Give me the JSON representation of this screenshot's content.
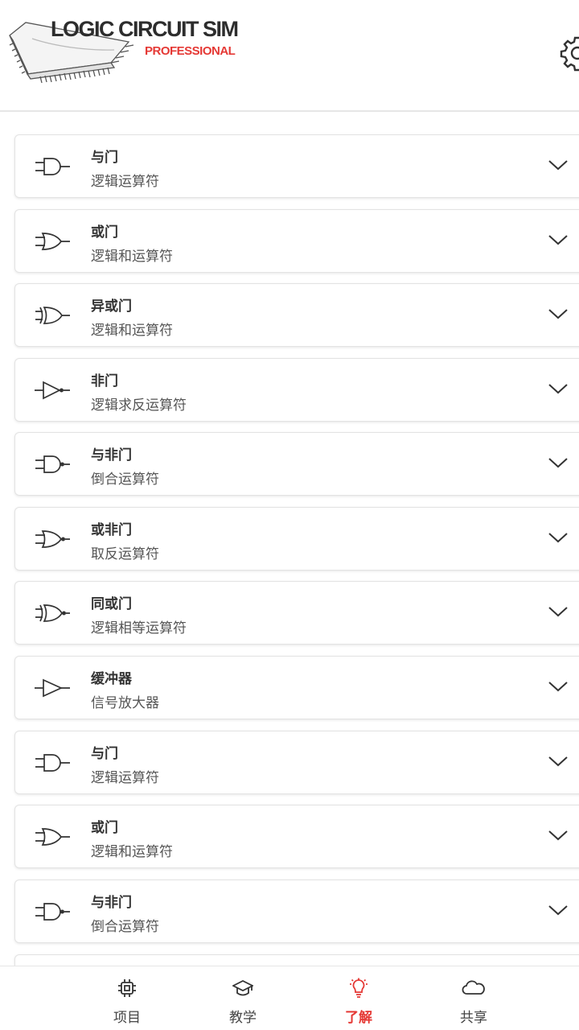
{
  "app": {
    "logo_title": "LOGIC CIRCUIT SIM",
    "logo_subtitle": "PROFESSIONAL"
  },
  "icons": {
    "settings": "gear-icon",
    "expand": "chevron-down-icon"
  },
  "colors": {
    "accent": "#e53935",
    "text": "#333333",
    "border": "#e3e3e3"
  },
  "gates": [
    {
      "title": "与门",
      "subtitle": "逻辑运算符",
      "icon": "and-gate-icon"
    },
    {
      "title": "或门",
      "subtitle": "逻辑和运算符",
      "icon": "or-gate-icon"
    },
    {
      "title": "异或门",
      "subtitle": "逻辑和运算符",
      "icon": "xor-gate-icon"
    },
    {
      "title": "非门",
      "subtitle": "逻辑求反运算符",
      "icon": "not-gate-icon"
    },
    {
      "title": "与非门",
      "subtitle": "倒合运算符",
      "icon": "nand-gate-icon"
    },
    {
      "title": "或非门",
      "subtitle": "取反运算符",
      "icon": "nor-gate-icon"
    },
    {
      "title": "同或门",
      "subtitle": "逻辑相等运算符",
      "icon": "xnor-gate-icon"
    },
    {
      "title": "缓冲器",
      "subtitle": "信号放大器",
      "icon": "buffer-gate-icon"
    },
    {
      "title": "与门",
      "subtitle": "逻辑运算符",
      "icon": "and-gate-icon"
    },
    {
      "title": "或门",
      "subtitle": "逻辑和运算符",
      "icon": "or-gate-icon"
    },
    {
      "title": "与非门",
      "subtitle": "倒合运算符",
      "icon": "nand-gate-icon"
    },
    {
      "title": "",
      "subtitle": "",
      "icon": ""
    }
  ],
  "tabs": [
    {
      "label": "项目",
      "icon": "chip-icon",
      "active": false
    },
    {
      "label": "教学",
      "icon": "graduation-cap-icon",
      "active": false
    },
    {
      "label": "了解",
      "icon": "lightbulb-icon",
      "active": true
    },
    {
      "label": "共享",
      "icon": "cloud-icon",
      "active": false
    }
  ]
}
